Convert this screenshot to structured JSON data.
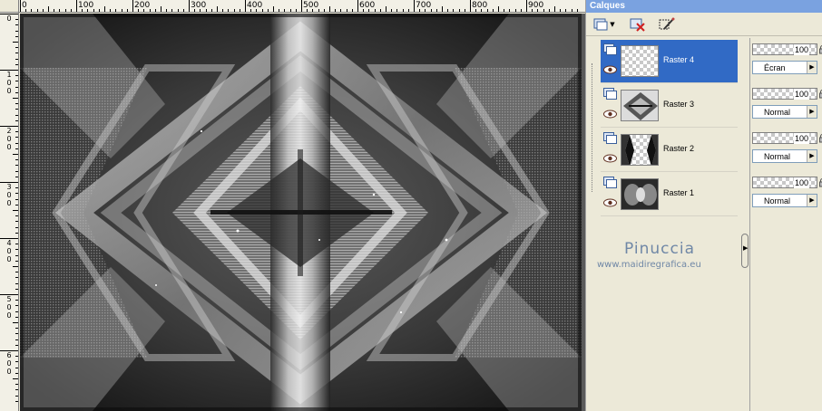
{
  "ruler": {
    "top_labels": [
      "0",
      "100",
      "200",
      "300",
      "400",
      "500",
      "600",
      "700",
      "800",
      "900"
    ],
    "left_labels": [
      [
        "0"
      ],
      [
        "1",
        "0",
        "0"
      ],
      [
        "2",
        "0",
        "0"
      ],
      [
        "3",
        "0",
        "0"
      ],
      [
        "4",
        "0",
        "0"
      ],
      [
        "5",
        "0",
        "0"
      ],
      [
        "6",
        "0",
        "0"
      ]
    ]
  },
  "palette": {
    "title": "Calques",
    "toolbar": {
      "new_layer_icon": "new-layer-icon",
      "dropdown_icon": "chevron-down-icon",
      "delete_icon": "delete-layer-icon",
      "mask_icon": "mask-edit-icon"
    },
    "layers": [
      {
        "name": "Raster 4",
        "opacity": "100",
        "blend": "Écran",
        "selected": true,
        "thumb": "checker"
      },
      {
        "name": "Raster 3",
        "opacity": "100",
        "blend": "Normal",
        "selected": false,
        "thumb": "pattern"
      },
      {
        "name": "Raster 2",
        "opacity": "100",
        "blend": "Normal",
        "selected": false,
        "thumb": "frame"
      },
      {
        "name": "Raster 1",
        "opacity": "100",
        "blend": "Normal",
        "selected": false,
        "thumb": "dark"
      }
    ],
    "watermark": {
      "name": "Pinuccia",
      "url": "www.maidiregrafica.eu"
    }
  },
  "colors": {
    "selection": "#316ac5",
    "title_bar": "#7aa2e0",
    "watermark": "#6f87a6",
    "panel_bg": "#ece9d8"
  }
}
